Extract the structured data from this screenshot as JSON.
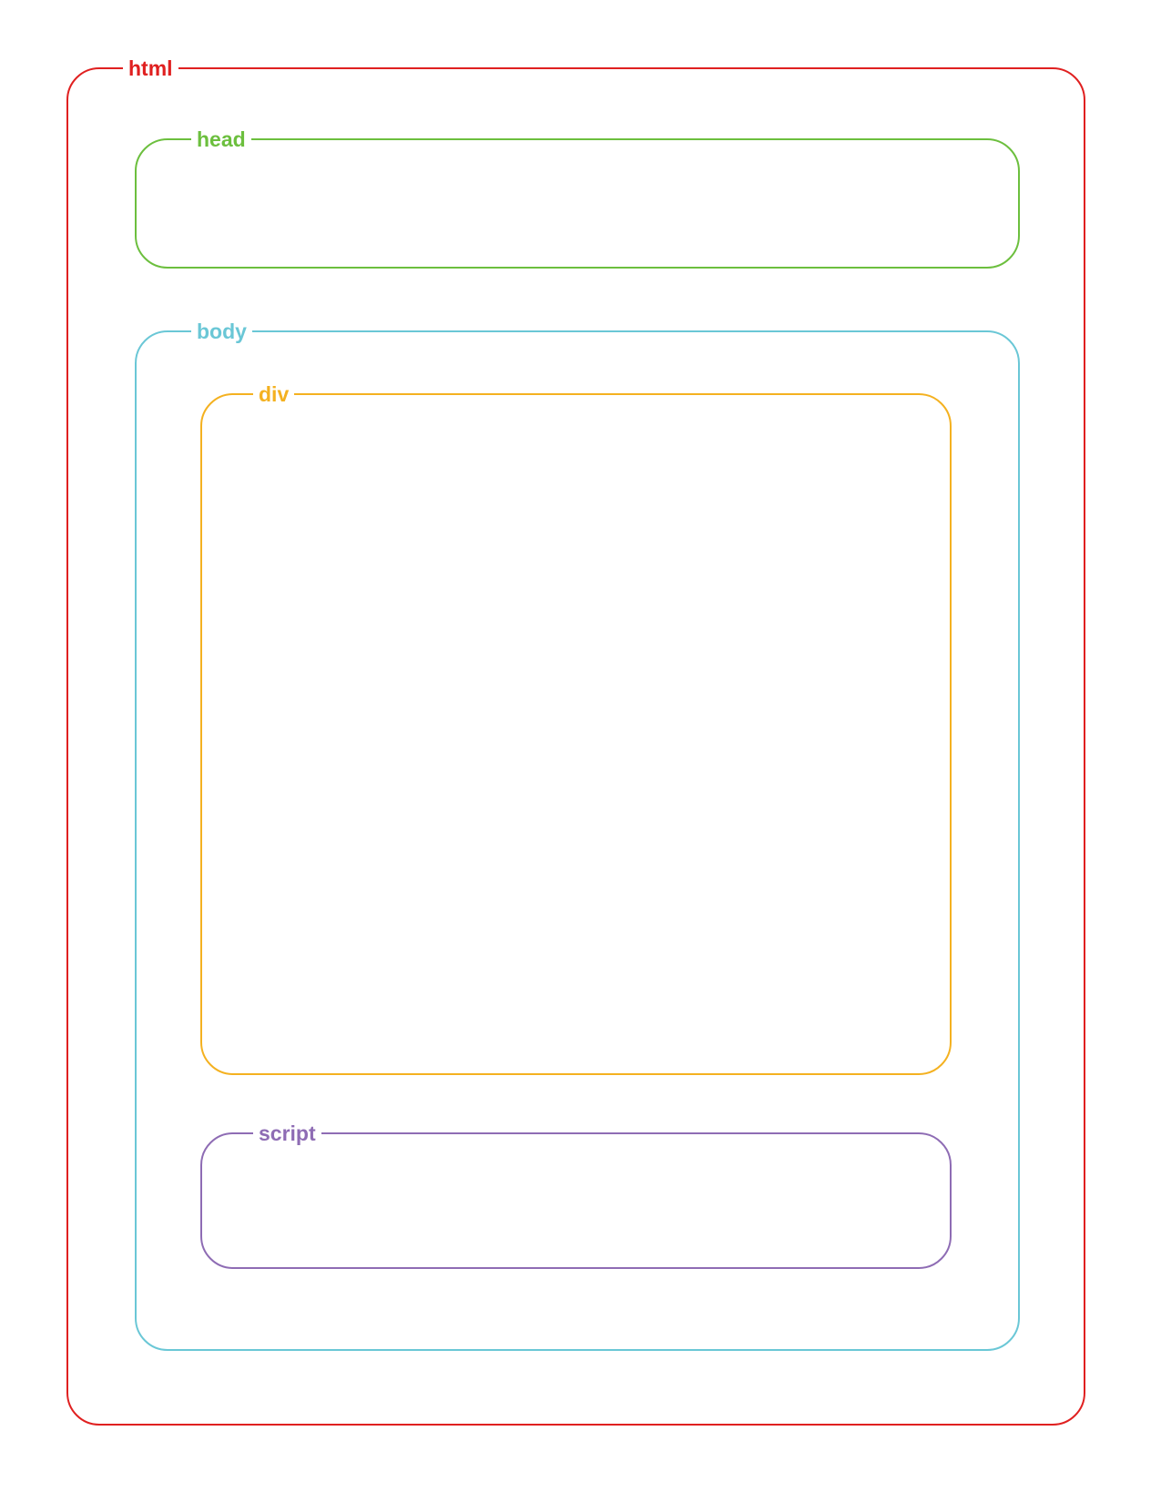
{
  "boxes": {
    "html": {
      "label": "html",
      "color": "#e02020"
    },
    "head": {
      "label": "head",
      "color": "#6cbf3e"
    },
    "body": {
      "label": "body",
      "color": "#6ac7d6"
    },
    "div": {
      "label": "div",
      "color": "#f4b120"
    },
    "script": {
      "label": "script",
      "color": "#8e6cb4"
    }
  }
}
